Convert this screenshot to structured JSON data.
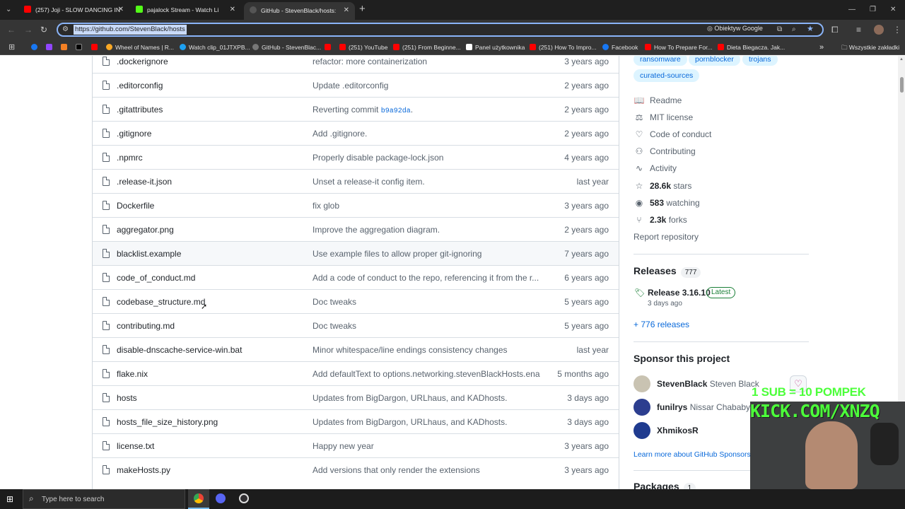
{
  "browser": {
    "tabs": [
      {
        "title": "(257) Joji - SLOW DANCING IN",
        "active": false,
        "fav_color": "#ff0000"
      },
      {
        "title": "pajalock Stream - Watch Li",
        "active": false,
        "fav_color": "#53fc18"
      },
      {
        "title": "GitHub - StevenBlack/hosts:",
        "active": true,
        "fav_color": "#ffffff"
      }
    ],
    "new_tab": "+",
    "url": "https://github.com/StevenBlack/hosts",
    "omnibox_badge": "Obiektyw Google",
    "window_controls": [
      "—",
      "❐",
      "✕"
    ],
    "bookmarks": [
      {
        "label": "",
        "fav_color": "#1877f2"
      },
      {
        "label": "",
        "fav_color": "#9146ff"
      },
      {
        "label": "",
        "fav_color": "#f48024"
      },
      {
        "label": "",
        "fav_color": "#000000"
      },
      {
        "label": "",
        "fav_color": "#ff0000"
      },
      {
        "label": "Wheel of Names | R...",
        "fav_color": "#f9a825"
      },
      {
        "label": "Watch clip_01JTXPB...",
        "fav_color": "#1da1f2"
      },
      {
        "label": "GitHub - StevenBlac...",
        "fav_color": "#ffffff"
      },
      {
        "label": "",
        "fav_color": "#ff0000"
      },
      {
        "label": "(251) YouTube",
        "fav_color": "#ff0000"
      },
      {
        "label": "(251) From Beginne...",
        "fav_color": "#ff0000"
      },
      {
        "label": "Panel użytkownika",
        "fav_color": "#ffffff"
      },
      {
        "label": "(251) How To Impro...",
        "fav_color": "#ff0000"
      },
      {
        "label": "Facebook",
        "fav_color": "#1877f2"
      },
      {
        "label": "How To Prepare For...",
        "fav_color": "#ff0000"
      },
      {
        "label": "Dieta Biegacza. Jak...",
        "fav_color": "#ff0000"
      }
    ],
    "bookmarks_more": "»",
    "all_bookmarks": "Wszystkie zakładki"
  },
  "files": [
    {
      "name": ".dockerignore",
      "message": "refactor: more containerization",
      "sha": "",
      "age": "3 years ago"
    },
    {
      "name": ".editorconfig",
      "message": "Update .editorconfig",
      "sha": "",
      "age": "2 years ago"
    },
    {
      "name": ".gitattributes",
      "message": "Reverting commit ",
      "sha": "b9a92da",
      "suffix": ".",
      "age": "2 years ago"
    },
    {
      "name": ".gitignore",
      "message": "Add .gitignore.",
      "sha": "",
      "age": "2 years ago"
    },
    {
      "name": ".npmrc",
      "message": "Properly disable package-lock.json",
      "sha": "",
      "age": "4 years ago"
    },
    {
      "name": ".release-it.json",
      "message": "Unset a release-it config item.",
      "sha": "",
      "age": "last year"
    },
    {
      "name": "Dockerfile",
      "message": "fix glob",
      "sha": "",
      "age": "3 years ago"
    },
    {
      "name": "aggregator.png",
      "message": "Improve the aggregation diagram.",
      "sha": "",
      "age": "2 years ago"
    },
    {
      "name": "blacklist.example",
      "message": "Use example files to allow proper git-ignoring",
      "sha": "",
      "age": "7 years ago"
    },
    {
      "name": "code_of_conduct.md",
      "message": "Add a code of conduct to the repo, referencing it from the r...",
      "sha": "",
      "age": "6 years ago"
    },
    {
      "name": "codebase_structure.md",
      "message": "Doc tweaks",
      "sha": "",
      "age": "5 years ago"
    },
    {
      "name": "contributing.md",
      "message": "Doc tweaks",
      "sha": "",
      "age": "5 years ago"
    },
    {
      "name": "disable-dnscache-service-win.bat",
      "message": "Minor whitespace/line endings consistency changes",
      "sha": "",
      "age": "last year"
    },
    {
      "name": "flake.nix",
      "message": "Add defaultText to options.networking.stevenBlackHosts.ena...",
      "sha": "",
      "age": "5 months ago"
    },
    {
      "name": "hosts",
      "message": "Updates from BigDargon, URLhaus, and KADhosts.",
      "sha": "",
      "age": "3 days ago"
    },
    {
      "name": "hosts_file_size_history.png",
      "message": "Updates from BigDargon, URLhaus, and KADhosts.",
      "sha": "",
      "age": "3 days ago"
    },
    {
      "name": "license.txt",
      "message": "Happy new year",
      "sha": "",
      "age": "3 years ago"
    },
    {
      "name": "makeHosts.py",
      "message": "Add versions that only render the extensions",
      "sha": "",
      "age": "3 years ago"
    }
  ],
  "sidebar": {
    "topics": [
      "ransomware",
      "pornblocker",
      "trojans",
      "curated-sources"
    ],
    "links": [
      {
        "label": "Readme",
        "strong": ""
      },
      {
        "label": "MIT license",
        "strong": ""
      },
      {
        "label": "Code of conduct",
        "strong": ""
      },
      {
        "label": "Contributing",
        "strong": ""
      },
      {
        "label": "Activity",
        "strong": ""
      },
      {
        "label": " stars",
        "strong": "28.6k"
      },
      {
        "label": " watching",
        "strong": "583"
      },
      {
        "label": " forks",
        "strong": "2.3k"
      }
    ],
    "report": "Report repository",
    "releases": {
      "title": "Releases",
      "count": "777",
      "latest_name": "Release 3.16.10",
      "latest_badge": "Latest",
      "latest_date": "3 days ago",
      "more": "+ 776 releases"
    },
    "sponsor": {
      "title": "Sponsor this project",
      "sponsors": [
        {
          "login": "StevenBlack",
          "name": "Steven Black"
        },
        {
          "login": "funilrys",
          "name": "Nissar Chababy"
        },
        {
          "login": "XhmikosR",
          "name": ""
        }
      ],
      "learn_more": "Learn more about GitHub Sponsors"
    },
    "packages": {
      "title": "Packages",
      "count": "1"
    }
  },
  "overlay": {
    "line1": "1 SUB = 10 POMPEK",
    "line2": "KICK.COM/XNZQ"
  },
  "taskbar": {
    "search_placeholder": "Type here to search"
  }
}
